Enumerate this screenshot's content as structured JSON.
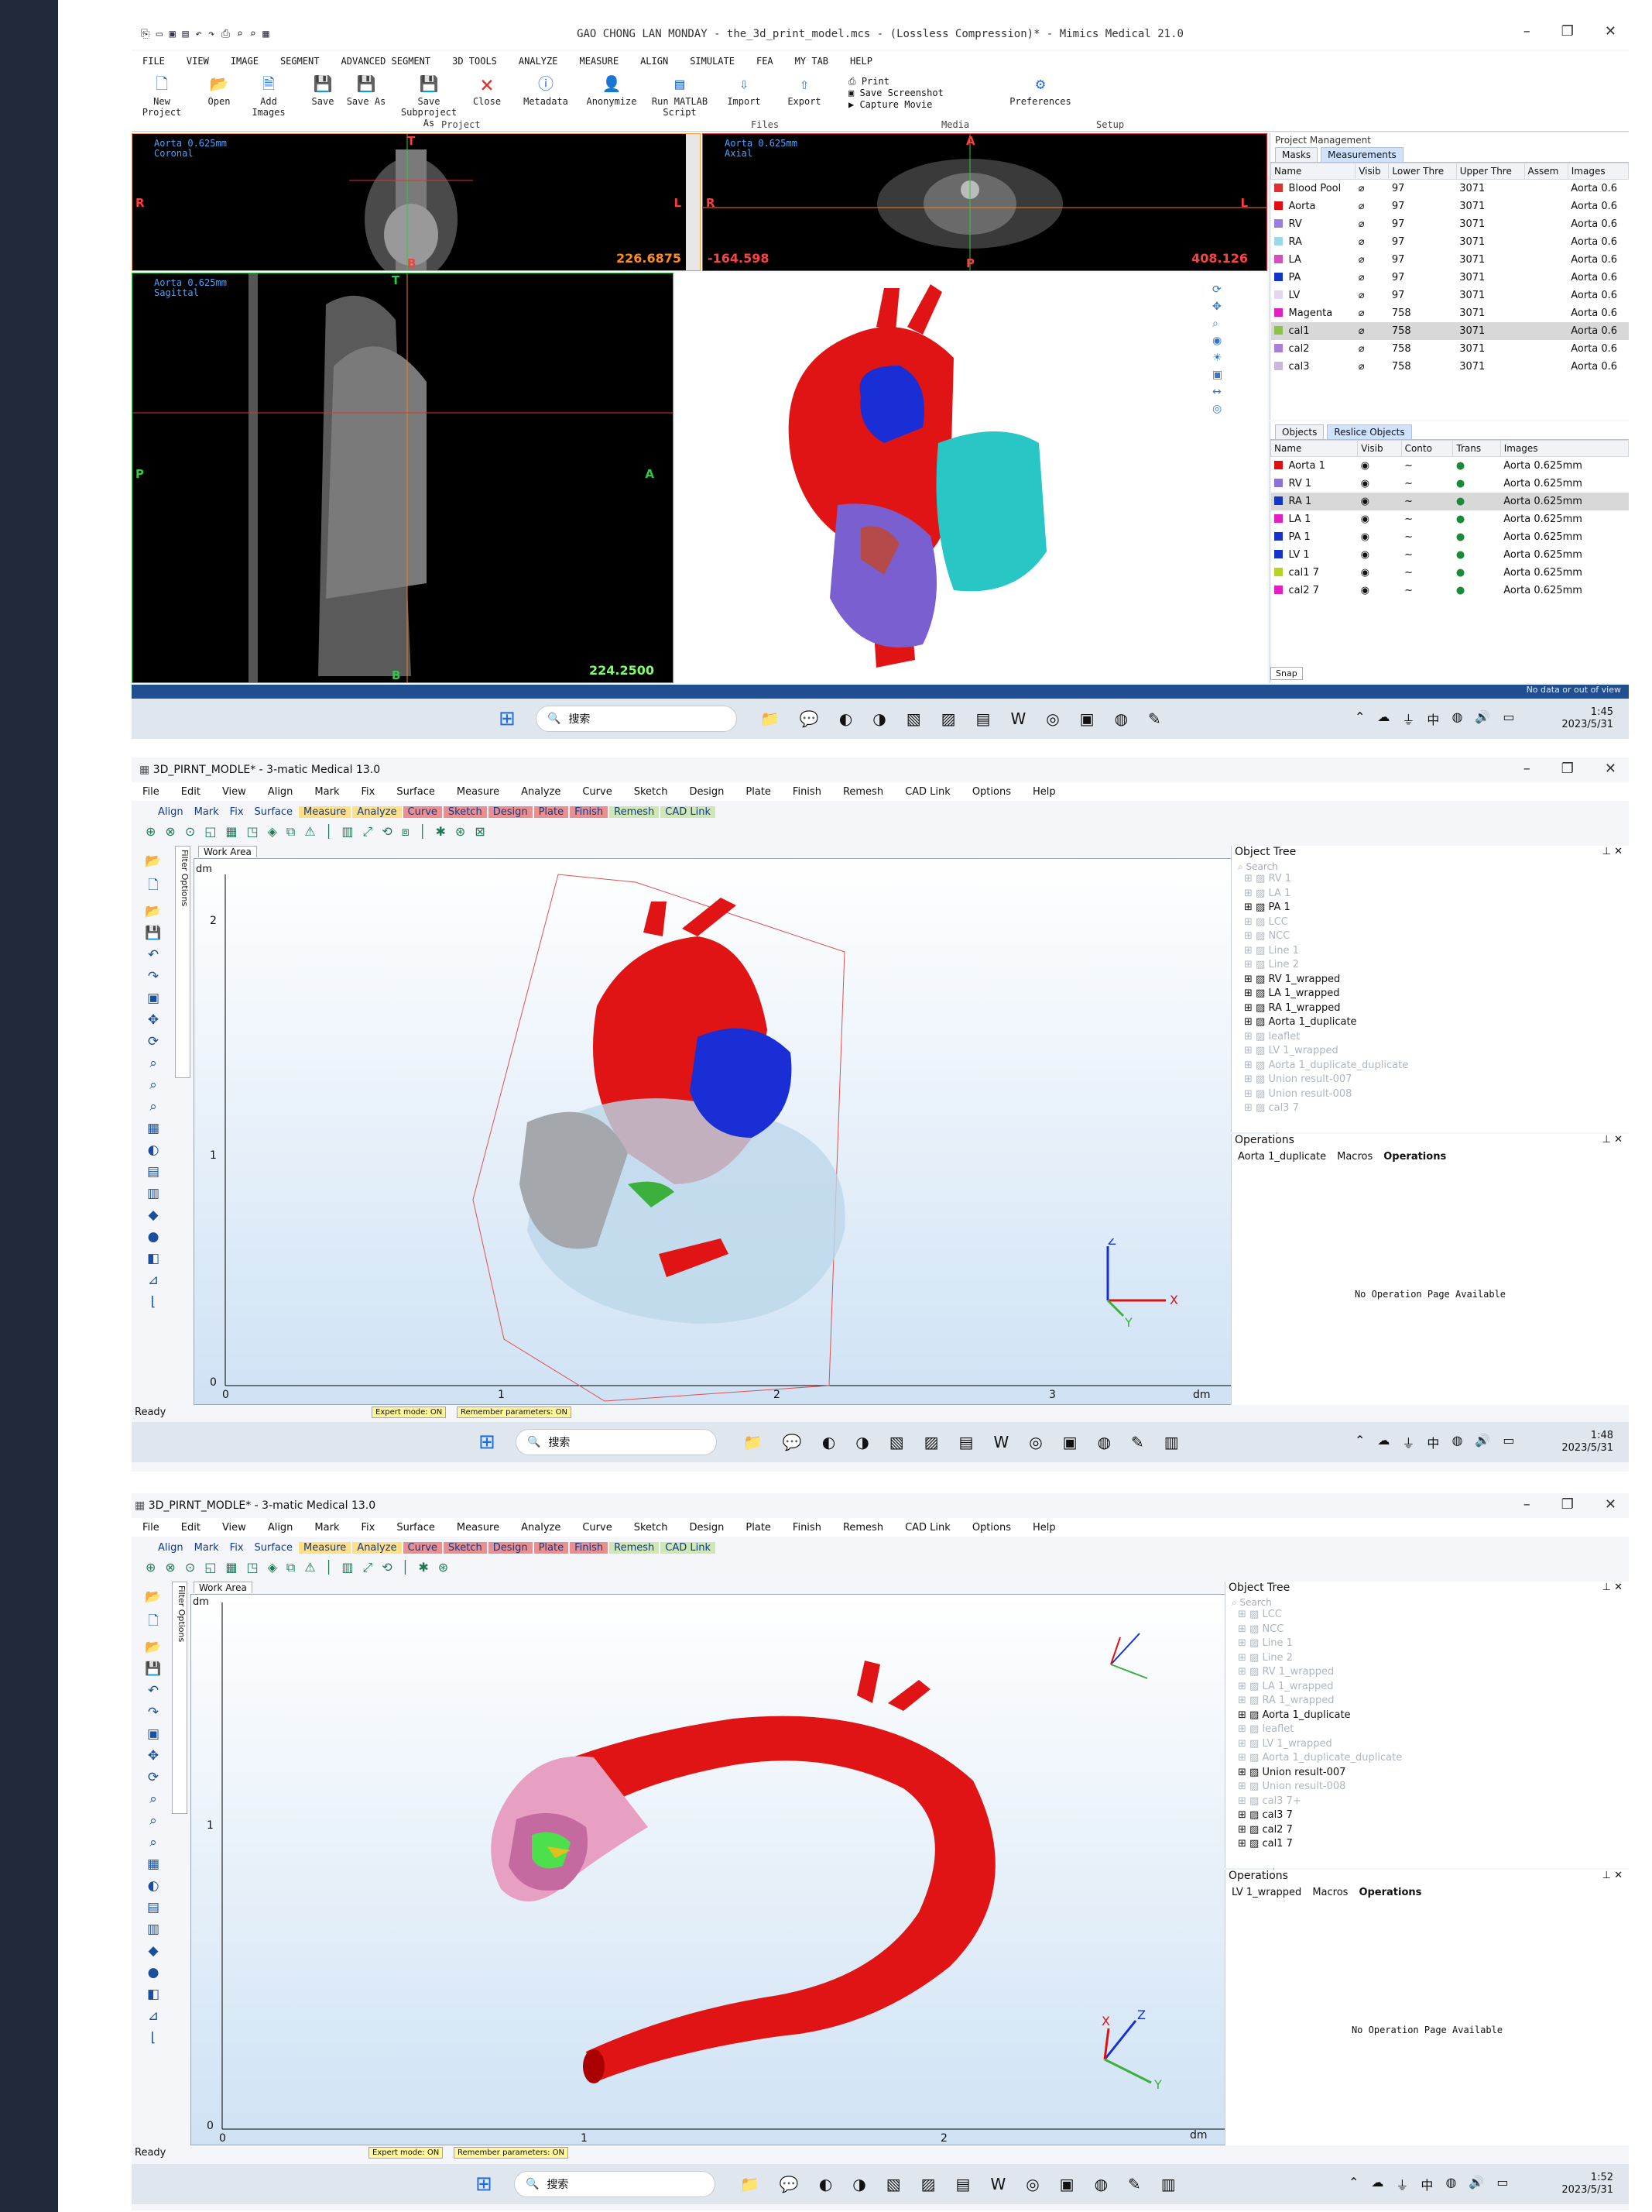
{
  "mimics": {
    "title": "GAO CHONG LAN MONDAY - the_3d_print_model.mcs -  (Lossless Compression)* - Mimics Medical 21.0",
    "menu": [
      "FILE",
      "VIEW",
      "IMAGE",
      "SEGMENT",
      "ADVANCED SEGMENT",
      "3D TOOLS",
      "ANALYZE",
      "MEASURE",
      "ALIGN",
      "SIMULATE",
      "FEA",
      "MY TAB",
      "HELP"
    ],
    "ribbon": {
      "new_project": "New Project",
      "open": "Open",
      "add_images": "Add Images",
      "save": "Save",
      "save_as": "Save As",
      "save_subproject": "Save Subproject As",
      "close": "Close",
      "metadata": "Metadata",
      "anonymize": "Anonymize",
      "run_matlab": "Run MATLAB Script",
      "import": "Import",
      "export": "Export",
      "print": "Print",
      "save_screenshot": "Save Screenshot",
      "capture_movie": "Capture Movie",
      "preferences": "Preferences",
      "group_project": "Project",
      "group_files": "Files",
      "group_media": "Media",
      "group_setup": "Setup"
    },
    "views": {
      "coronal_label": "Aorta 0.625mm\nCoronal",
      "coronal_value": "226.6875",
      "axial_label": "Aorta 0.625mm\nAxial",
      "axial_value_left": "-164.598",
      "axial_value_right": "408.126",
      "sagittal_label": "Aorta 0.625mm\nSagittal",
      "sagittal_value": "224.2500",
      "orient": {
        "T": "T",
        "B": "B",
        "R": "R",
        "L": "L",
        "A": "A",
        "P": "P"
      }
    },
    "project_management": {
      "title": "Project Management",
      "tabs": [
        "Masks",
        "Measurements"
      ],
      "headers": [
        "Name",
        "Visib",
        "Lower Thre",
        "Upper Thre",
        "Assem",
        "Images"
      ],
      "rows": [
        {
          "name": "Blood Pool",
          "lower": "97",
          "upper": "3071",
          "image": "Aorta 0.6",
          "color": "#e03030"
        },
        {
          "name": "Aorta",
          "lower": "97",
          "upper": "3071",
          "image": "Aorta 0.6",
          "color": "#e01010"
        },
        {
          "name": "RV",
          "lower": "97",
          "upper": "3071",
          "image": "Aorta 0.6",
          "color": "#9a7de0"
        },
        {
          "name": "RA",
          "lower": "97",
          "upper": "3071",
          "image": "Aorta 0.6",
          "color": "#9fd6ea"
        },
        {
          "name": "LA",
          "lower": "97",
          "upper": "3071",
          "image": "Aorta 0.6",
          "color": "#d64fc0"
        },
        {
          "name": "PA",
          "lower": "97",
          "upper": "3071",
          "image": "Aorta 0.6",
          "color": "#1433c8"
        },
        {
          "name": "LV",
          "lower": "97",
          "upper": "3071",
          "image": "Aorta 0.6",
          "color": "#e2d6f0"
        },
        {
          "name": "Magenta",
          "lower": "758",
          "upper": "3071",
          "image": "Aorta 0.6",
          "color": "#e020c0"
        },
        {
          "name": "cal1",
          "lower": "758",
          "upper": "3071",
          "image": "Aorta 0.6",
          "color": "#8bc34a"
        },
        {
          "name": "cal2",
          "lower": "758",
          "upper": "3071",
          "image": "Aorta 0.6",
          "color": "#a97fd8"
        },
        {
          "name": "cal3",
          "lower": "758",
          "upper": "3071",
          "image": "Aorta 0.6",
          "color": "#c9b7e0"
        }
      ]
    },
    "objects": {
      "tabs": [
        "Objects",
        "Reslice Objects"
      ],
      "headers": [
        "Name",
        "Visib",
        "Conto",
        "Trans",
        "Images"
      ],
      "rows": [
        {
          "name": "Aorta 1",
          "image": "Aorta 0.625mm",
          "color": "#e01010"
        },
        {
          "name": "RV 1",
          "image": "Aorta 0.625mm",
          "color": "#8c72d8"
        },
        {
          "name": "RA 1",
          "image": "Aorta 0.625mm",
          "color": "#1433c8"
        },
        {
          "name": "LA 1",
          "image": "Aorta 0.625mm",
          "color": "#e020c0"
        },
        {
          "name": "PA 1",
          "image": "Aorta 0.625mm",
          "color": "#1433c8"
        },
        {
          "name": "LV 1",
          "image": "Aorta 0.625mm",
          "color": "#1433c8"
        },
        {
          "name": "cal1 7",
          "image": "Aorta 0.625mm",
          "color": "#b8d420"
        },
        {
          "name": "cal2 7",
          "image": "Aorta 0.625mm",
          "color": "#e020c0"
        }
      ],
      "snap_label": "Snap"
    },
    "status_text": "No data or out of view",
    "clock_time": "1:45",
    "clock_date": "2023/5/31"
  },
  "matic1": {
    "title": "3D_PIRNT_MODLE* - 3-matic Medical 13.0",
    "menu": [
      "File",
      "Edit",
      "View",
      "Align",
      "Mark",
      "Fix",
      "Surface",
      "Measure",
      "Analyze",
      "Curve",
      "Sketch",
      "Design",
      "Plate",
      "Finish",
      "Remesh",
      "CAD Link",
      "Options",
      "Help"
    ],
    "toolbar": [
      "Align",
      "Mark",
      "Fix",
      "Surface",
      "Measure",
      "Analyze",
      "Curve",
      "Sketch",
      "Design",
      "Plate",
      "Finish",
      "Remesh",
      "CAD Link"
    ],
    "work_area": "Work Area",
    "filter_options": "Filter Options",
    "axis_unit": "dm",
    "y_ticks": [
      "2",
      "1",
      "0"
    ],
    "x_ticks": [
      "0",
      "1",
      "2",
      "3"
    ],
    "object_tree_title": "Object Tree",
    "tree_search": "Search",
    "tree": [
      {
        "label": "RV 1",
        "dim": true
      },
      {
        "label": "LA 1",
        "dim": true
      },
      {
        "label": "PA 1",
        "dim": false
      },
      {
        "label": "LCC",
        "dim": true
      },
      {
        "label": "NCC",
        "dim": true
      },
      {
        "label": "Line 1",
        "dim": true
      },
      {
        "label": "Line 2",
        "dim": true
      },
      {
        "label": "RV 1_wrapped",
        "dim": false
      },
      {
        "label": "LA 1_wrapped",
        "dim": false
      },
      {
        "label": "RA 1_wrapped",
        "dim": false
      },
      {
        "label": "Aorta 1_duplicate",
        "dim": false
      },
      {
        "label": "leaflet",
        "dim": true
      },
      {
        "label": "LV 1_wrapped",
        "dim": true
      },
      {
        "label": "Aorta 1_duplicate_duplicate",
        "dim": true
      },
      {
        "label": "Union result-007",
        "dim": true
      },
      {
        "label": "Union result-008",
        "dim": true
      },
      {
        "label": "cal3 7",
        "dim": true
      }
    ],
    "operations_title": "Operations",
    "op_tabs": [
      "Aorta 1_duplicate",
      "Macros",
      "Operations"
    ],
    "no_op": "No Operation Page Available",
    "ready": "Ready",
    "expert": "Expert mode: ON",
    "remember": "Remember parameters: ON",
    "clock_time": "1:48",
    "clock_date": "2023/5/31"
  },
  "matic2": {
    "title": "3D_PIRNT_MODLE* - 3-matic Medical 13.0",
    "tree": [
      {
        "label": "LCC",
        "dim": true
      },
      {
        "label": "NCC",
        "dim": true
      },
      {
        "label": "Line 1",
        "dim": true
      },
      {
        "label": "Line 2",
        "dim": true
      },
      {
        "label": "RV 1_wrapped",
        "dim": true
      },
      {
        "label": "LA 1_wrapped",
        "dim": true
      },
      {
        "label": "RA 1_wrapped",
        "dim": true
      },
      {
        "label": "Aorta 1_duplicate",
        "dim": false
      },
      {
        "label": "leaflet",
        "dim": true
      },
      {
        "label": "LV 1_wrapped",
        "dim": true
      },
      {
        "label": "Aorta 1_duplicate_duplicate",
        "dim": true
      },
      {
        "label": "Union result-007",
        "dim": false
      },
      {
        "label": "Union result-008",
        "dim": true
      },
      {
        "label": "cal3 7+",
        "dim": true
      },
      {
        "label": "cal3 7",
        "dim": false
      },
      {
        "label": "cal2 7",
        "dim": false
      },
      {
        "label": "cal1 7",
        "dim": false
      }
    ],
    "op_tabs": [
      "LV 1_wrapped",
      "Macros",
      "Operations"
    ],
    "y_ticks": [
      "1",
      "0"
    ],
    "x_ticks": [
      "0",
      "1",
      "2"
    ],
    "clock_time": "1:52",
    "clock_date": "2023/5/31"
  },
  "taskbar": {
    "search_placeholder": "搜索",
    "ime": "中"
  }
}
